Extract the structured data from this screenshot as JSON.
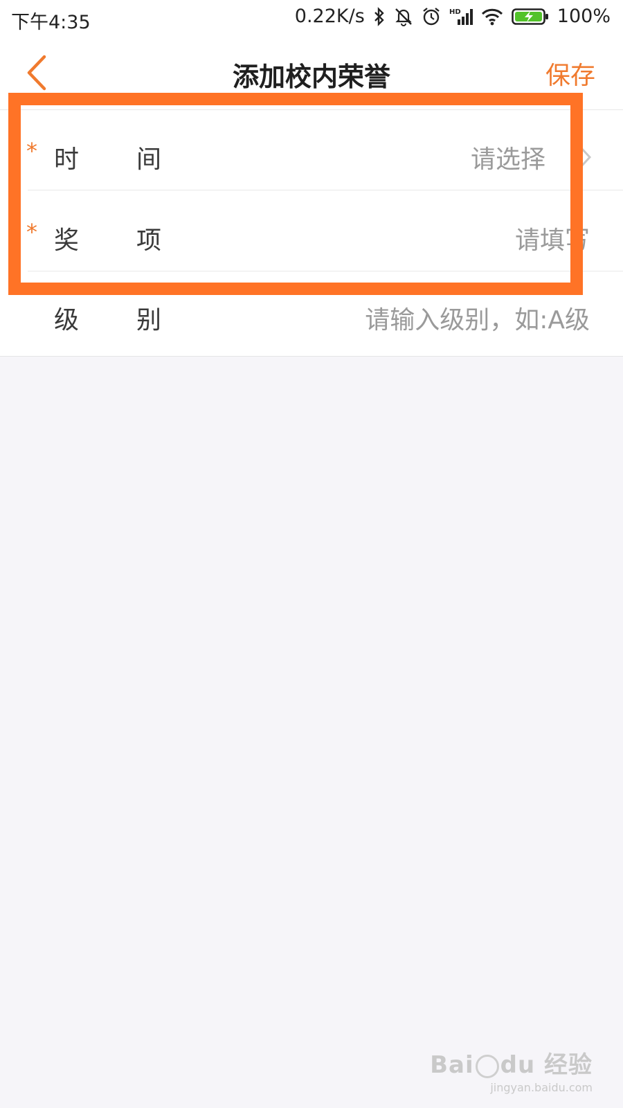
{
  "status_bar": {
    "time": "下午4:35",
    "net_speed": "0.22K/s",
    "battery": "100%",
    "icons": [
      "bluetooth-icon",
      "mute-bell-icon",
      "alarm-icon",
      "hd-signal-icon",
      "wifi-icon",
      "battery-charging-icon"
    ]
  },
  "nav": {
    "title": "添加校内荣誉",
    "save_label": "保存",
    "back_icon": "chevron-left-icon"
  },
  "form": {
    "rows": [
      {
        "label": "时间",
        "required": true,
        "required_mark": "*",
        "placeholder": "请选择",
        "has_chevron": true
      },
      {
        "label": "奖项",
        "required": true,
        "required_mark": "*",
        "placeholder": "请填写",
        "has_chevron": false
      },
      {
        "label": "级别",
        "required": false,
        "required_mark": "",
        "placeholder": "请输入级别，如:A级",
        "has_chevron": false
      }
    ]
  },
  "colors": {
    "accent": "#f07a2e",
    "highlight_box": "#ff7326",
    "page_bg": "#f6f5f9",
    "label": "#3a3a3a",
    "placeholder": "#9a9a9a",
    "battery_fill": "#52c22a"
  },
  "watermark": {
    "logo_text_left": "Bai",
    "logo_text_right": "经验",
    "url": "jingyan.baidu.com"
  }
}
